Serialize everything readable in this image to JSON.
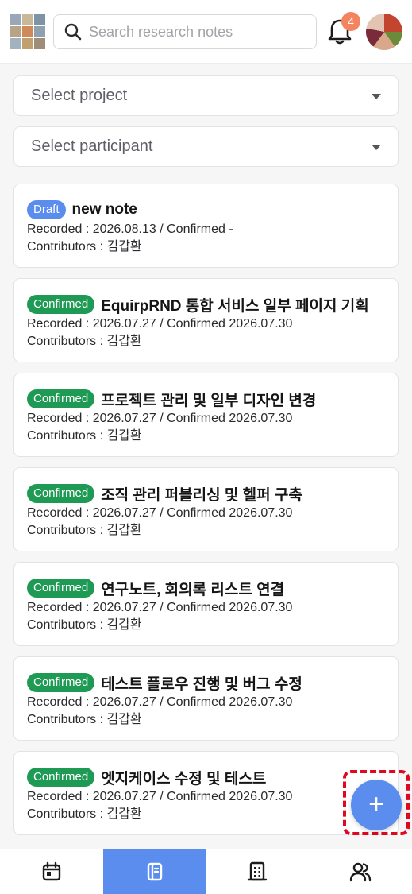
{
  "header": {
    "search_placeholder": "Search research notes",
    "notification_count": "4"
  },
  "filters": {
    "project_placeholder": "Select project",
    "participant_placeholder": "Select participant"
  },
  "notes": [
    {
      "status": "Draft",
      "title": "new note",
      "recorded": "Recorded : 2026.08.13 / Confirmed -",
      "contributors": "Contributors : 김갑환"
    },
    {
      "status": "Confirmed",
      "title": "EquirpRND 통합 서비스 일부 페이지 기획",
      "recorded": "Recorded : 2026.07.27 / Confirmed 2026.07.30",
      "contributors": "Contributors : 김갑환"
    },
    {
      "status": "Confirmed",
      "title": "프로젝트 관리 및 일부 디자인 변경",
      "recorded": "Recorded : 2026.07.27 / Confirmed 2026.07.30",
      "contributors": "Contributors : 김갑환"
    },
    {
      "status": "Confirmed",
      "title": "조직 관리 퍼블리싱 및 헬퍼 구축",
      "recorded": "Recorded : 2026.07.27 / Confirmed 2026.07.30",
      "contributors": "Contributors : 김갑환"
    },
    {
      "status": "Confirmed",
      "title": "연구노트, 회의록 리스트 연결",
      "recorded": "Recorded : 2026.07.27 / Confirmed 2026.07.30",
      "contributors": "Contributors : 김갑환"
    },
    {
      "status": "Confirmed",
      "title": "테스트 플로우 진행 및 버그 수정",
      "recorded": "Recorded : 2026.07.27 / Confirmed 2026.07.30",
      "contributors": "Contributors : 김갑환"
    },
    {
      "status": "Confirmed",
      "title": "엣지케이스 수정 및 테스트",
      "recorded": "Recorded : 2026.07.27 / Confirmed 2026.07.30",
      "contributors": "Contributors : 김갑환"
    }
  ],
  "fab": {
    "label": "+"
  },
  "nav": {
    "items": [
      {
        "icon": "calendar-icon",
        "active": false
      },
      {
        "icon": "notebook-icon",
        "active": true
      },
      {
        "icon": "building-icon",
        "active": false
      },
      {
        "icon": "users-icon",
        "active": false
      }
    ]
  },
  "colors": {
    "accent": "#5b8def",
    "draft": "#5b8def",
    "confirmed": "#1f9a54",
    "badge": "#f4845f",
    "highlight": "#e0081f"
  }
}
